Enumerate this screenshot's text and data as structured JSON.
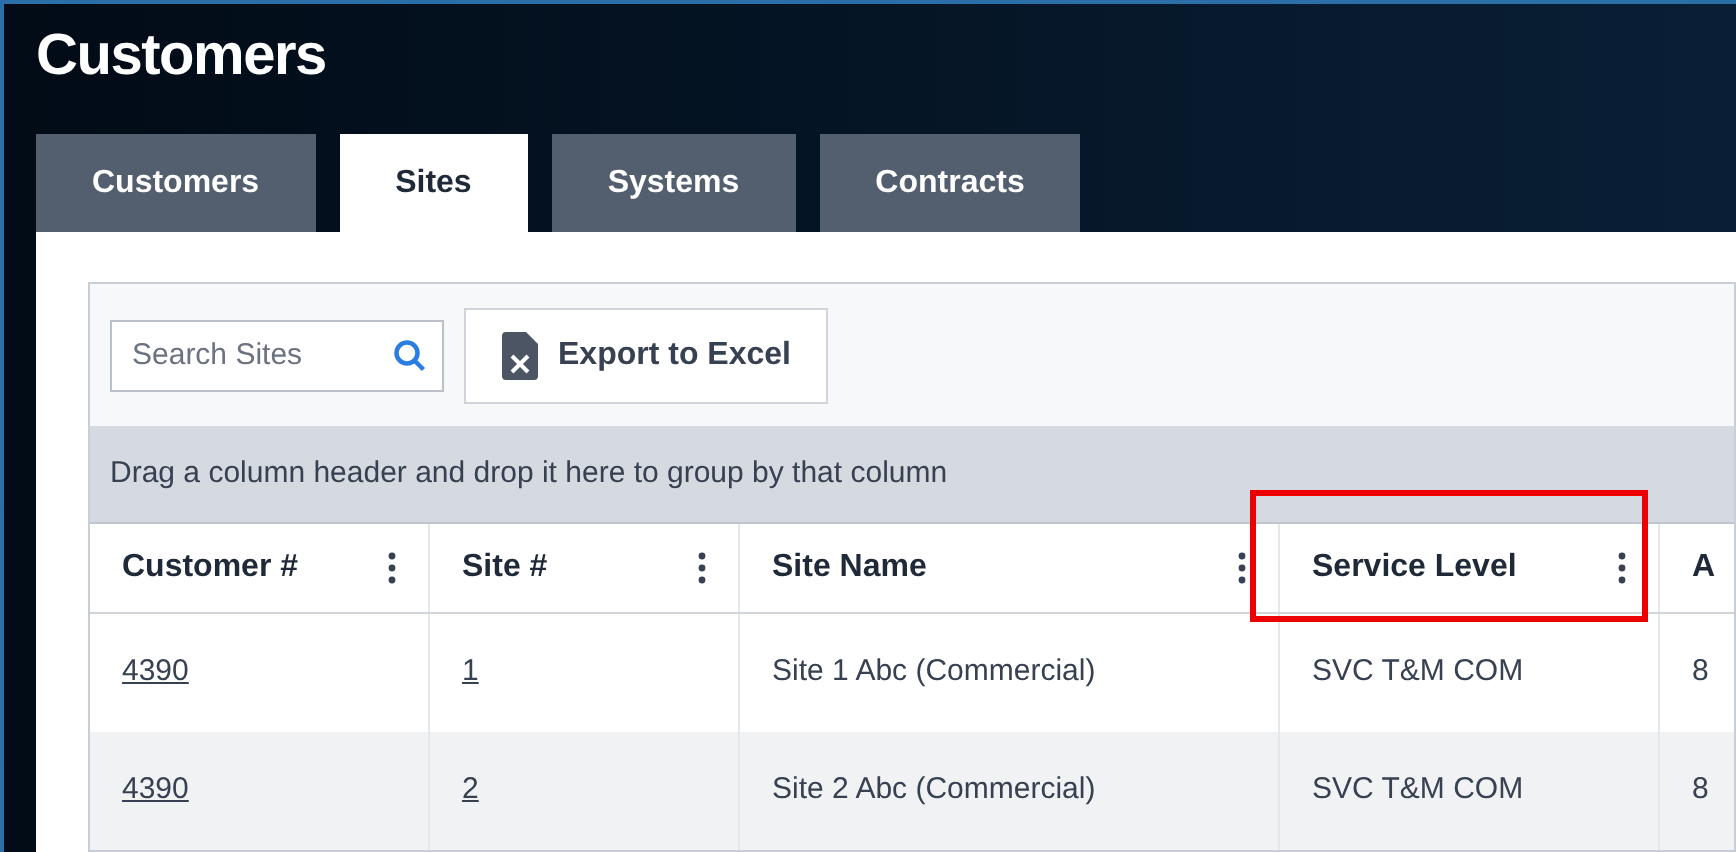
{
  "page": {
    "title": "Customers"
  },
  "tabs": [
    {
      "label": "Customers",
      "selected": false
    },
    {
      "label": "Sites",
      "selected": true
    },
    {
      "label": "Systems",
      "selected": false
    },
    {
      "label": "Contracts",
      "selected": false
    }
  ],
  "toolbar": {
    "search": {
      "placeholder": "Search Sites"
    },
    "export_button": "Export to Excel"
  },
  "group_panel": "Drag a column header and drop it here to group by that column",
  "table": {
    "columns": [
      {
        "label": "Customer #",
        "highlighted": false
      },
      {
        "label": "Site #",
        "highlighted": false
      },
      {
        "label": "Site Name",
        "highlighted": false
      },
      {
        "label": "Service Level",
        "highlighted": true
      },
      {
        "label": "A",
        "highlighted": false
      }
    ],
    "rows": [
      {
        "cells": [
          {
            "text": "4390",
            "kind": "link"
          },
          {
            "text": "1",
            "kind": "link"
          },
          {
            "text": "Site 1 Abc (Commercial)",
            "kind": "text"
          },
          {
            "text": "SVC T&M COM",
            "kind": "text"
          },
          {
            "text": "8",
            "kind": "text"
          }
        ]
      },
      {
        "cells": [
          {
            "text": "4390",
            "kind": "link"
          },
          {
            "text": "2",
            "kind": "link"
          },
          {
            "text": "Site 2 Abc (Commercial)",
            "kind": "text"
          },
          {
            "text": "SVC T&M COM",
            "kind": "text"
          },
          {
            "text": "8",
            "kind": "text"
          }
        ]
      }
    ]
  }
}
